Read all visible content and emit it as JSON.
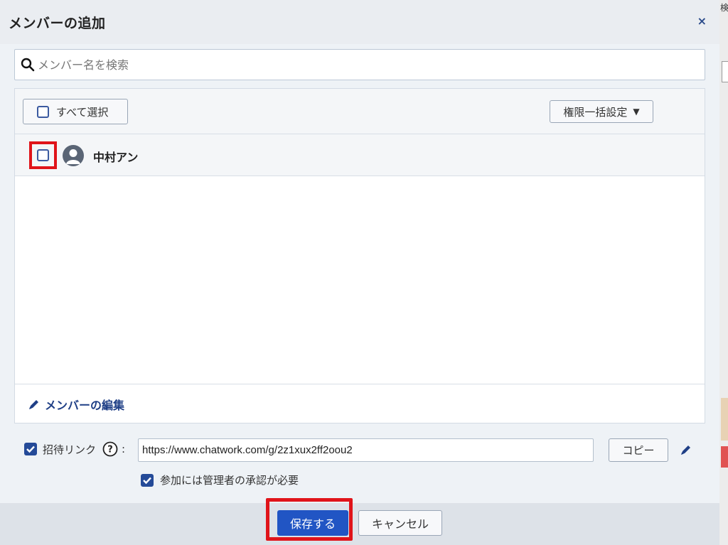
{
  "dialog": {
    "title": "メンバーの追加",
    "close_label": "×"
  },
  "search": {
    "placeholder": "メンバー名を検索",
    "value": ""
  },
  "toolbar": {
    "select_all_label": "すべて選択",
    "bulk_role_label": "権限一括設定"
  },
  "members": [
    {
      "name": "中村アン",
      "checked": false
    }
  ],
  "edit_members_label": "メンバーの編集",
  "invite": {
    "enabled": true,
    "label": "招待リンク",
    "colon": ":",
    "url": "https://www.chatwork.com/g/2z1xux2ff2oou2",
    "copy_label": "コピー",
    "approval_required": true,
    "approval_label": "参加には管理者の承認が必要"
  },
  "footer": {
    "save_label": "保存する",
    "cancel_label": "キャンセル"
  },
  "background": {
    "fragment_text": "検"
  },
  "colors": {
    "primary": "#2155c4",
    "highlight": "#e0141a",
    "link": "#1f3f86",
    "checkbox": "#244a98"
  }
}
